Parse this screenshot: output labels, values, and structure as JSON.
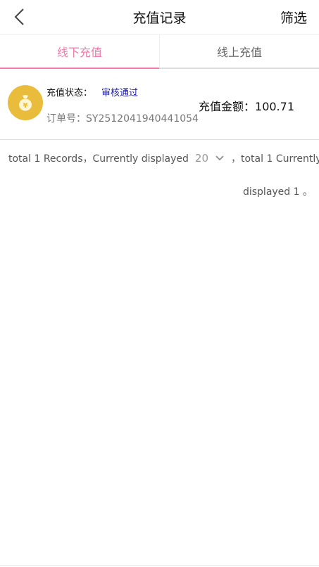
{
  "header": {
    "title": "充值记录",
    "filter_label": "筛选"
  },
  "tabs": [
    {
      "label": "线下充值",
      "active": true
    },
    {
      "label": "线上充值",
      "active": false
    }
  ],
  "records": [
    {
      "icon": "money-bag-yuan-icon",
      "status_label": "充值状态：",
      "status_value": "审核通过",
      "order_label": "订单号：",
      "order_number": "SY2512041940441054",
      "amount_label": "充值金额：",
      "amount_value": "100.71"
    }
  ],
  "pagination": {
    "text_before": "total 1 Records，Currently displayed",
    "page_size": "20",
    "text_after": "，total 1 Currently",
    "text_line2": "displayed 1 。"
  },
  "colors": {
    "accent": "#f07aa8",
    "status": "#1a1aa8",
    "icon_bg": "#e9bd3b"
  }
}
